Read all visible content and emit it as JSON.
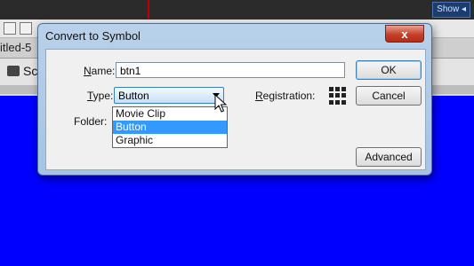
{
  "background": {
    "show_button": "Show",
    "document_title": "itled-5",
    "scene_label": "Sc"
  },
  "dialog": {
    "title": "Convert to Symbol",
    "close_glyph": "x",
    "name": {
      "label_prefix": "",
      "label_mnemonic": "N",
      "label_rest": "ame:",
      "value": "btn1"
    },
    "type": {
      "label_mnemonic": "T",
      "label_rest": "ype:",
      "selected": "Button",
      "options": [
        "Movie Clip",
        "Button",
        "Graphic"
      ]
    },
    "folder": {
      "label": "Folder:"
    },
    "registration": {
      "label_mnemonic": "R",
      "label_rest": "egistration:"
    },
    "buttons": {
      "ok": "OK",
      "cancel": "Cancel",
      "advanced": "Advanced"
    }
  },
  "colors": {
    "stage": "#0000ff",
    "selection": "#3399ff",
    "dialog_frame": "#b9d1ea"
  }
}
